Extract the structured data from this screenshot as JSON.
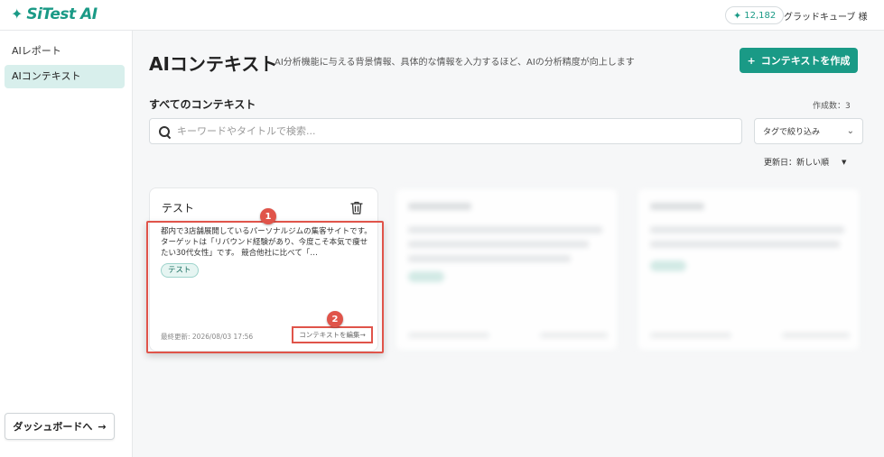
{
  "app": {
    "logo_text": "SiTest AI",
    "credits": "12,182",
    "user": "グラッドキューブ 様"
  },
  "colors": {
    "accent": "#1a9a86",
    "highlight": "#e0544a"
  },
  "sidebar": {
    "items": [
      {
        "label": "AIレポート",
        "active": false
      },
      {
        "label": "AIコンテキスト",
        "active": true
      }
    ],
    "dashboard_button": "ダッシュボードへ",
    "dashboard_arrow": "→"
  },
  "header": {
    "title": "AIコンテキスト",
    "description": "AI分析機能に与える背景情報、具体的な情報を入力するほど、AIの分析精度が向上します",
    "create_button": "コンテキストを作成",
    "create_icon": "+"
  },
  "list": {
    "section_title": "すべてのコンテキスト",
    "count": "作成数：3",
    "search_placeholder": "キーワードやタイトルで検索...",
    "tag_filter": "タグで絞り込み",
    "sort": "更新日：新しい順"
  },
  "cards": [
    {
      "title": "テスト",
      "description": "都内で3店舗展開しているパーソナルジムの集客サイトです。ターゲットは「リバウンド経験があり、今度こそ本気で痩せたい30代女性」です。 競合他社に比べて「…",
      "tag": "テスト",
      "updated": "最終更新: 2026/08/03 17:56",
      "edit_label": "コンテキストを編集→"
    }
  ],
  "annotations": {
    "badge_1": "1",
    "badge_2": "2"
  }
}
